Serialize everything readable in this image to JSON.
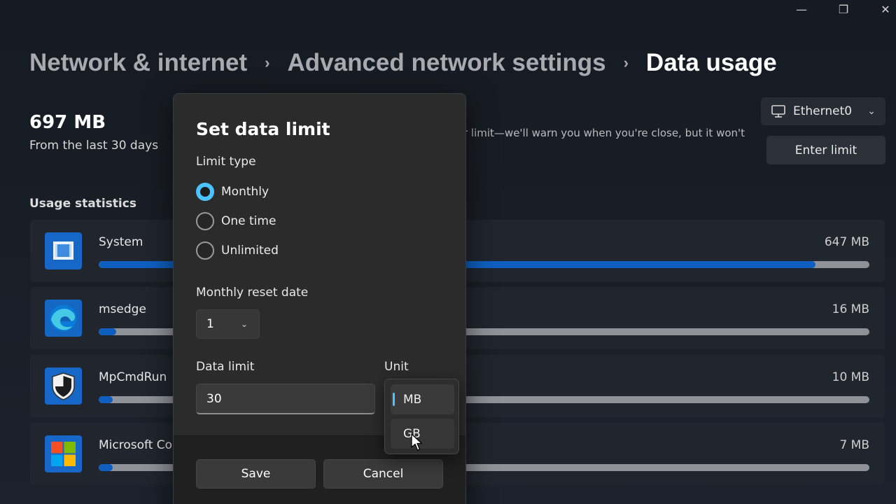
{
  "window": {
    "minimize_glyph": "—",
    "restore_glyph": "❐",
    "close_glyph": "✕"
  },
  "breadcrumb": {
    "items": [
      "Network & internet",
      "Advanced network settings",
      "Data usage"
    ],
    "separator": "›"
  },
  "summary": {
    "total": "697 MB",
    "period": "From the last 30 days"
  },
  "adapter": {
    "label": "Ethernet0",
    "icon": "monitor-network-icon"
  },
  "limit_description": "r limit—we'll warn you when you're close, but it won't",
  "enter_limit_label": "Enter limit",
  "usage_statistics": {
    "heading": "Usage statistics",
    "apps": [
      {
        "name": "System",
        "amount": "647 MB",
        "fraction": 0.93,
        "icon": "system-icon"
      },
      {
        "name": "msedge",
        "amount": "16 MB",
        "fraction": 0.023,
        "icon": "edge-icon"
      },
      {
        "name": "MpCmdRun",
        "amount": "10 MB",
        "fraction": 0.015,
        "icon": "defender-shield-icon"
      },
      {
        "name": "Microsoft Co",
        "amount": "7 MB",
        "fraction": 0.01,
        "icon": "microsoft-logo-icon"
      }
    ]
  },
  "dialog": {
    "title": "Set data limit",
    "limit_type_label": "Limit type",
    "limit_types": [
      "Monthly",
      "One time",
      "Unlimited"
    ],
    "selected_limit_type": "Monthly",
    "reset_date_label": "Monthly reset date",
    "reset_date_value": "1",
    "data_limit_label": "Data limit",
    "data_limit_value": "30",
    "unit_label": "Unit",
    "unit_options": [
      "MB",
      "GB"
    ],
    "selected_unit": "MB",
    "hovered_unit": "GB",
    "save_label": "Save",
    "cancel_label": "Cancel"
  },
  "colors": {
    "accent": "#4cc2ff",
    "progress": "#0f5fc0",
    "background": "#1a1e27"
  }
}
